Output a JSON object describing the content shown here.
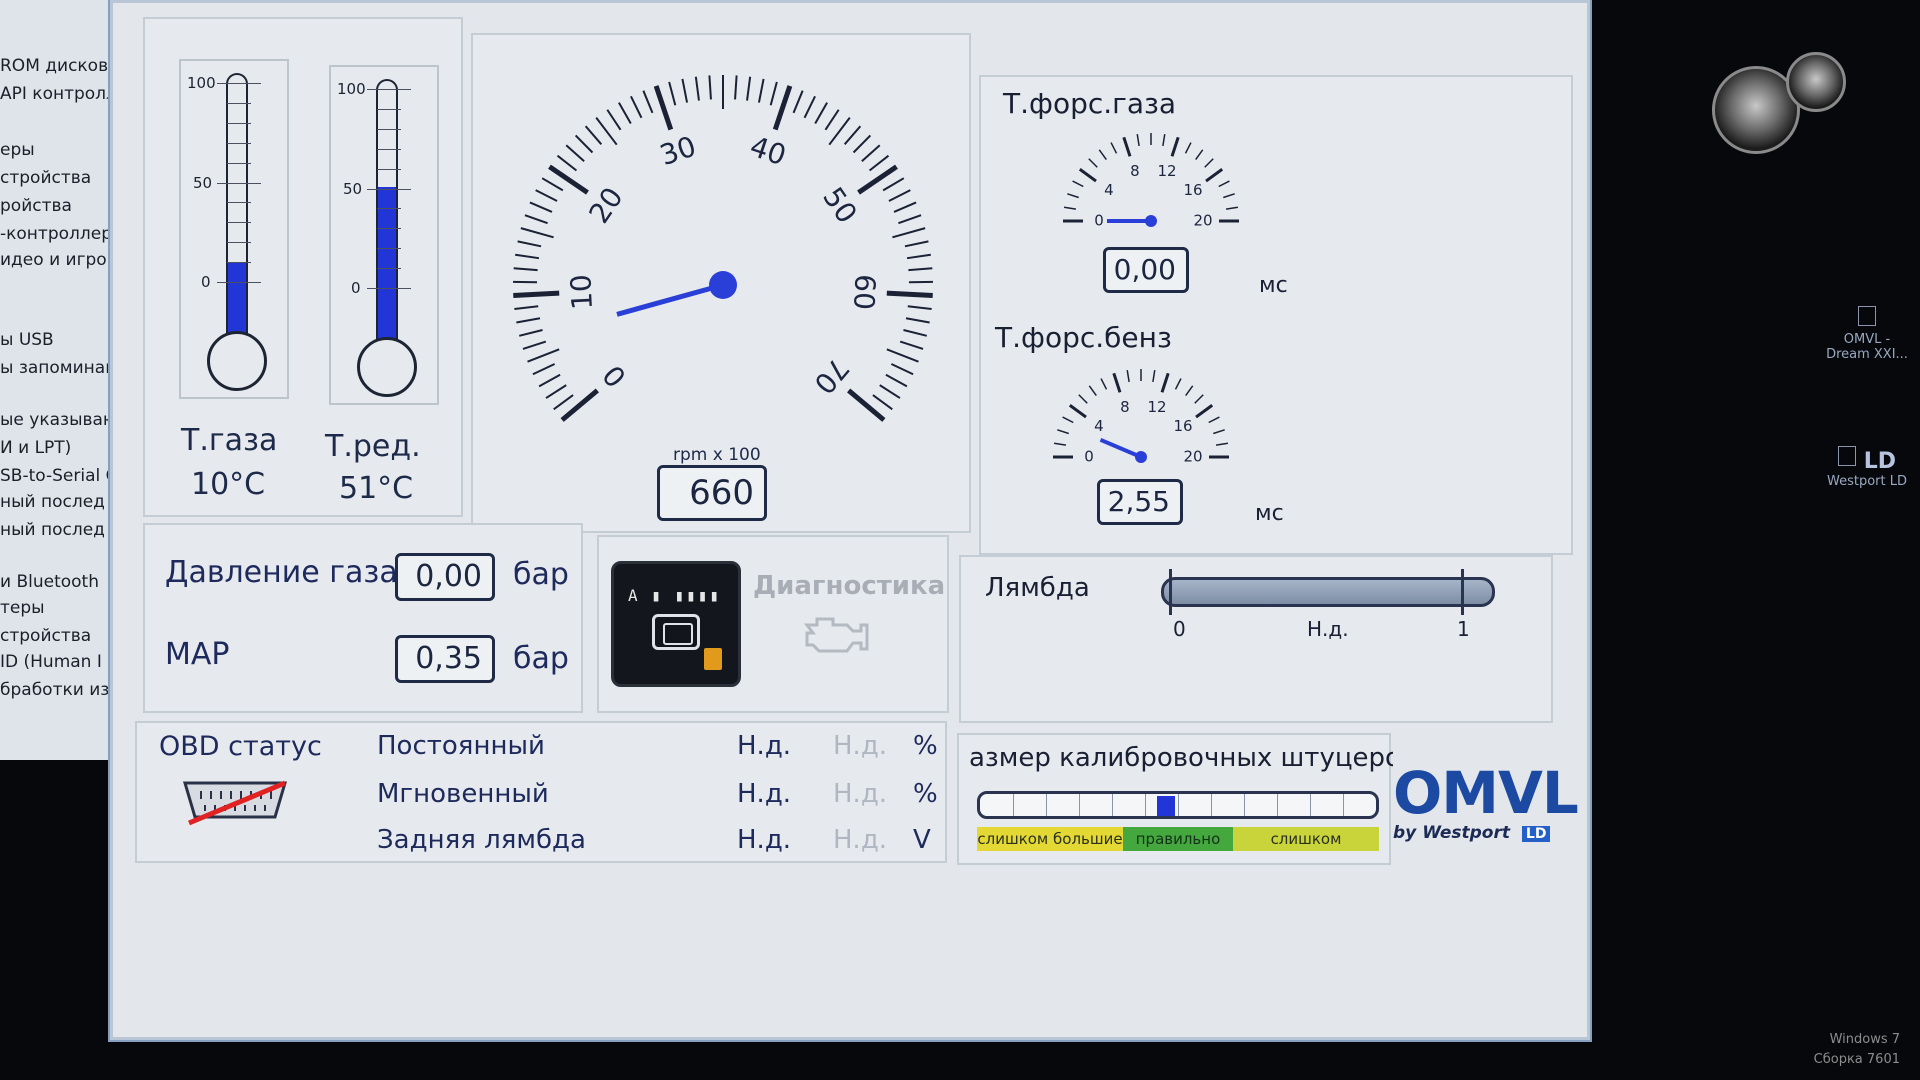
{
  "background": {
    "device_list": [
      "ROM дисковод",
      "API контролл",
      "еры",
      "стройства",
      "ройства",
      "-контроллер",
      "идео и игров",
      "ы USB",
      "ы запоминак",
      "ые указываю",
      "И и LPT)",
      "SB-to-Serial C",
      "ный послед",
      "ный послед",
      "и Bluetooth",
      "теры",
      "стройства",
      "ID (Human I",
      "бработки из"
    ],
    "desktop_icons": [
      {
        "label": "OMVL -",
        "sublabel": "Dream XXI..."
      },
      {
        "label": "LD",
        "sublabel": "Westport LD"
      }
    ],
    "os_watermark": [
      "Windows 7",
      "Сборка 7601"
    ]
  },
  "window": {
    "controls": [
      "–",
      "□",
      "✕"
    ]
  },
  "thermometers": [
    {
      "title": "Т.газа",
      "value_text": "10°C",
      "value": 10,
      "scale": [
        0,
        50,
        100
      ],
      "fill_color": "#2236d8"
    },
    {
      "title": "Т.ред.",
      "value_text": "51°C",
      "value": 51,
      "scale": [
        0,
        50,
        100
      ],
      "fill_color": "#2236d8"
    }
  ],
  "rpm": {
    "unit": "rpm x 100",
    "value_text": "660",
    "value": 6.6,
    "scale_labels": [
      "0",
      "10",
      "20",
      "30",
      "40",
      "50",
      "60",
      "70"
    ],
    "range": [
      0,
      70
    ],
    "needle_color": "#2a3fd8"
  },
  "injection": {
    "gas": {
      "title": "Т.форс.газа",
      "value_text": "0,00",
      "value": 0,
      "unit": "мс",
      "scale_labels": [
        "0",
        "4",
        "8",
        "12",
        "16",
        "20"
      ]
    },
    "petrol": {
      "title": "Т.форс.бенз",
      "value_text": "2,55",
      "value": 2.55,
      "unit": "мс",
      "scale_labels": [
        "0",
        "4",
        "8",
        "12",
        "16",
        "20"
      ]
    }
  },
  "pressure": {
    "gas": {
      "label": "Давление газа",
      "value": "0,00",
      "unit": "бар"
    },
    "map": {
      "label": "MAP",
      "value": "0,35",
      "unit": "бар"
    }
  },
  "diagnostics": {
    "label": "Диагностика",
    "switch_markings": "A ▮ ▮▮▮▮"
  },
  "lambda": {
    "label": "Лямбда",
    "min_label": "0",
    "max_label": "1",
    "value_text": "Н.д."
  },
  "obd": {
    "label": "OBD статус",
    "rows": [
      {
        "label": "Постоянный",
        "value1": "Н.д.",
        "value2": "Н.д.",
        "unit": "%"
      },
      {
        "label": "Мгновенный",
        "value1": "Н.д.",
        "value2": "Н.д.",
        "unit": "%"
      },
      {
        "label": "Задняя лямбда",
        "value1": "Н.д.",
        "value2": "Н.д.",
        "unit": "V"
      }
    ]
  },
  "calibration": {
    "title": "азмер калибровочных штуцеро",
    "position": 0.47,
    "zones": [
      "слишком большие",
      "правильно",
      "слишком"
    ]
  },
  "logo": {
    "main": "OMVL",
    "by": "by",
    "brand": "Westport",
    "badge": "LD"
  },
  "colors": {
    "accent_blue": "#2236d8",
    "text_dark_blue": "#1e2a5c",
    "panel_bg": "#e6eaee",
    "logo_blue": "#1c4aa2"
  }
}
